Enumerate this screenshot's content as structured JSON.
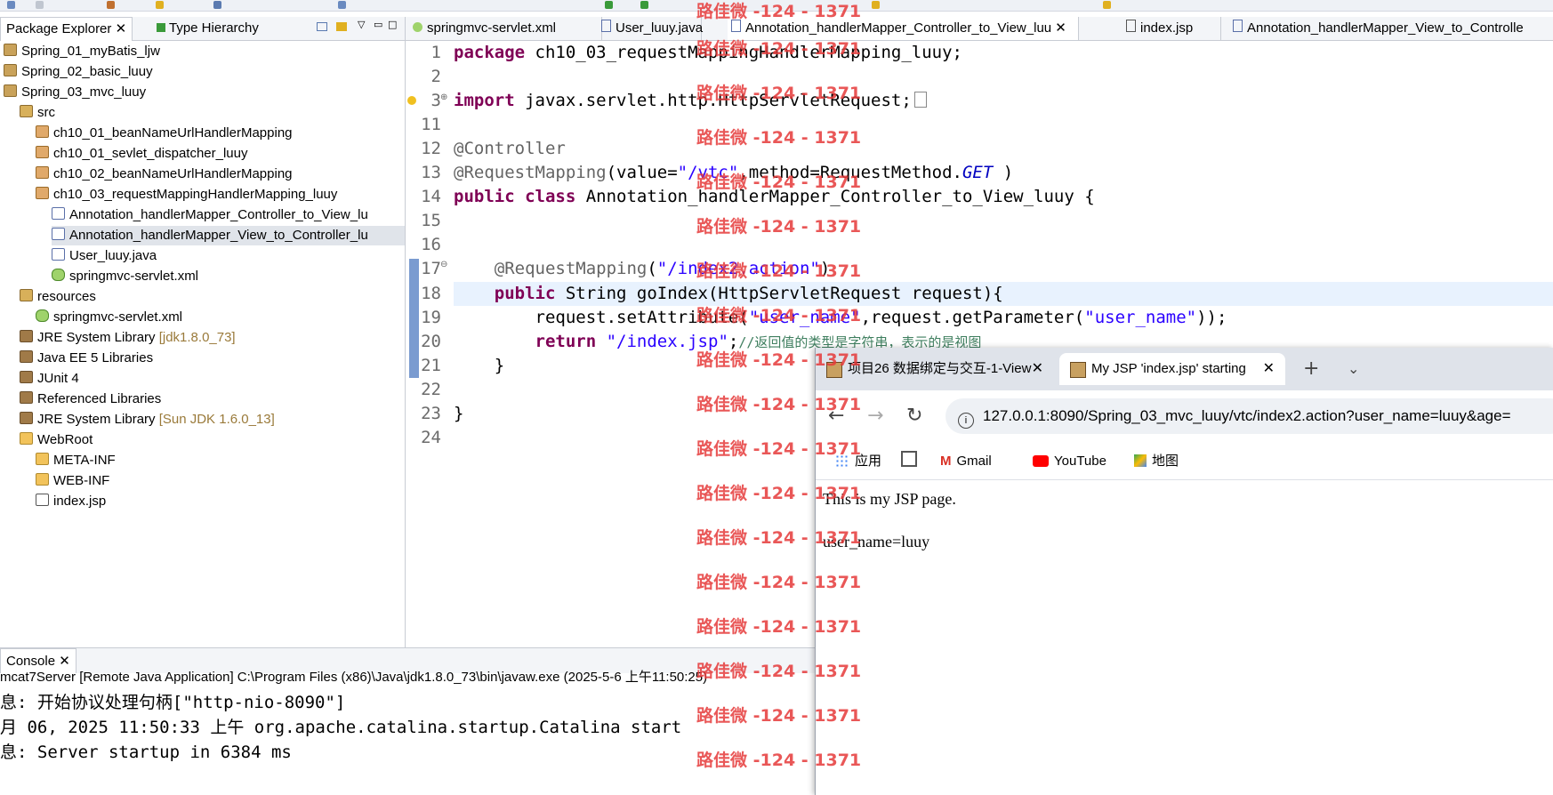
{
  "left_tabs": {
    "package_explorer": "Package Explorer ✕",
    "type_hierarchy": "Type Hierarchy"
  },
  "tree": [
    {
      "label": "Spring_01_myBatis_ljw",
      "suffix": "",
      "icon": "project-icon"
    },
    {
      "label": "Spring_02_basic_luuy",
      "suffix": "",
      "icon": "project-icon"
    },
    {
      "label": "Spring_03_mvc_luuy",
      "suffix": "",
      "icon": "project-icon"
    },
    {
      "label": "src",
      "suffix": "",
      "icon": "source-folder-icon"
    },
    {
      "label": "ch10_01_beanNameUrlHandlerMapping",
      "suffix": "",
      "icon": "package-icon"
    },
    {
      "label": "ch10_01_sevlet_dispatcher_luuy",
      "suffix": "",
      "icon": "package-icon"
    },
    {
      "label": "ch10_02_beanNameUrlHandlerMapping",
      "suffix": "",
      "icon": "package-icon"
    },
    {
      "label": "ch10_03_requestMappingHandlerMapping_luuy",
      "suffix": "",
      "icon": "package-icon"
    },
    {
      "label": "Annotation_handlerMapper_Controller_to_View_lu",
      "suffix": "",
      "icon": "java-file-icon"
    },
    {
      "label": "Annotation_handlerMapper_View_to_Controller_lu",
      "suffix": "",
      "icon": "java-file-icon"
    },
    {
      "label": "User_luuy.java",
      "suffix": "",
      "icon": "java-file-icon"
    },
    {
      "label": "springmvc-servlet.xml",
      "suffix": "",
      "icon": "xml-file-icon"
    },
    {
      "label": "resources",
      "suffix": "",
      "icon": "source-folder-icon"
    },
    {
      "label": "springmvc-servlet.xml",
      "suffix": "",
      "icon": "xml-file-icon"
    },
    {
      "label": "JRE System Library ",
      "suffix": "[jdk1.8.0_73]",
      "icon": "library-icon"
    },
    {
      "label": "Java EE 5 Libraries",
      "suffix": "",
      "icon": "library-icon"
    },
    {
      "label": "JUnit 4",
      "suffix": "",
      "icon": "library-icon"
    },
    {
      "label": "Referenced Libraries",
      "suffix": "",
      "icon": "library-icon"
    },
    {
      "label": "JRE System Library ",
      "suffix": "[Sun JDK 1.6.0_13]",
      "icon": "library-icon"
    },
    {
      "label": "WebRoot",
      "suffix": "",
      "icon": "folder-icon"
    },
    {
      "label": "META-INF",
      "suffix": "",
      "icon": "folder-icon"
    },
    {
      "label": "WEB-INF",
      "suffix": "",
      "icon": "folder-icon"
    },
    {
      "label": "index.jsp",
      "suffix": "",
      "icon": "jsp-file-icon"
    }
  ],
  "editor_tabs": [
    "springmvc-servlet.xml",
    "User_luuy.java",
    "Annotation_handlerMapper_Controller_to_View_luu ✕",
    "index.jsp",
    "Annotation_handlerMapper_View_to_Controlle"
  ],
  "code": {
    "line_numbers": [
      "1",
      "2",
      "3",
      "11",
      "12",
      "13",
      "14",
      "15",
      "16",
      "17",
      "18",
      "19",
      "20",
      "21",
      "22",
      "23",
      "24"
    ],
    "l1_kw": "package",
    "l1_rest": " ch10_03_requestMappingHandlerMapping_luuy;",
    "l3_kw": "import",
    "l3_rest": " javax.servlet.http.HttpServletRequest;",
    "l12": "@Controller",
    "l13_a": "@RequestMapping",
    "l13_b": "(value=",
    "l13_str": "\"/vtc\"",
    "l13_c": ",method=RequestMethod.",
    "l13_get": "GET",
    "l13_d": " )",
    "l14_kw1": "public",
    "l14_kw2": "class",
    "l14_rest": " Annotation_handlerMapper_Controller_to_View_luuy {",
    "l17_a": "    @RequestMapping",
    "l17_b": "(",
    "l17_str": "\"/index2.action\"",
    "l17_c": ")",
    "l18_kw": "    public",
    "l18_rest": " String goIndex(HttpServletRequest request){",
    "l19_a": "        request.setAttribute(",
    "l19_s1": "\"user_name\"",
    "l19_b": ",request.getParameter(",
    "l19_s2": "\"user_name\"",
    "l19_c": "));",
    "l20_kw": "        return",
    "l20_sp": " ",
    "l20_str": "\"/index.jsp\"",
    "l20_semi": ";",
    "l20_cmt": "//返回值的类型是字符串，表示的是视图",
    "l21": "    }",
    "l23": "}"
  },
  "browser": {
    "tab1": "项目26 数据绑定与交互-1-View",
    "tab2": "My JSP 'index.jsp' starting pa",
    "url": "127.0.0.1:8090/Spring_03_mvc_luuy/vtc/index2.action?user_name=luuy&age=",
    "bookmarks": {
      "apps": "应用",
      "gmail": "Gmail",
      "youtube": "YouTube",
      "maps": "地图"
    },
    "content_line1": "This is my JSP page.",
    "content_line2": "user_name=luuy"
  },
  "console": {
    "tab": "Console ✕",
    "header": "mcat7Server [Remote Java Application] C:\\Program Files (x86)\\Java\\jdk1.8.0_73\\bin\\javaw.exe (2025-5-6 上午11:50:25)",
    "lines": [
      "息: 开始协议处理句柄[\"http-nio-8090\"]",
      "月 06, 2025 11:50:33 上午 org.apache.catalina.startup.Catalina start",
      "息: Server startup in 6384 ms"
    ]
  },
  "watermark": "路佳微 -124 - 1371",
  "colors": {
    "keyword": "#7f0055",
    "string": "#2a00ff",
    "annotation": "#646464",
    "comment": "#3f7f5f",
    "watermark": "#e63a3a"
  }
}
